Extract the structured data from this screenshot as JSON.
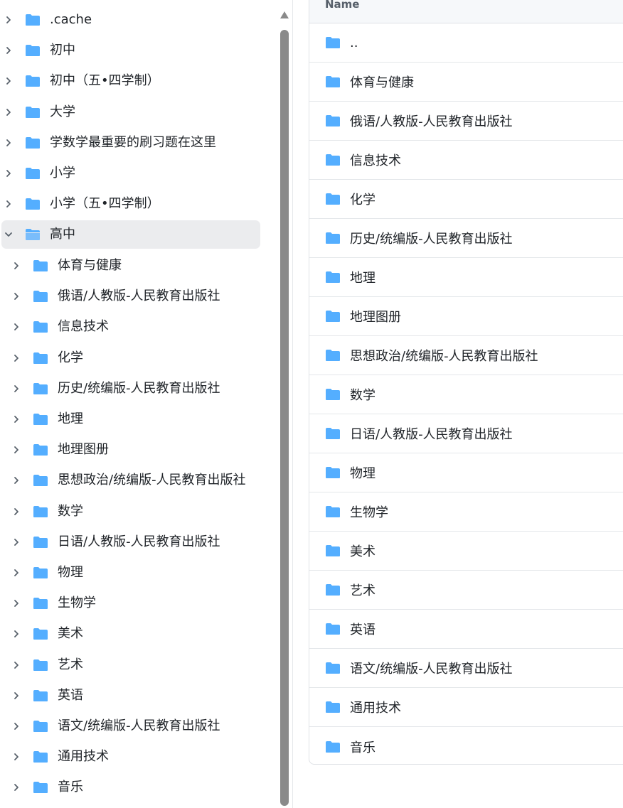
{
  "tree": {
    "root_items": [
      {
        "label": ".cache",
        "expanded": false
      },
      {
        "label": "初中",
        "expanded": false
      },
      {
        "label": "初中（五•四学制）",
        "expanded": false
      },
      {
        "label": "大学",
        "expanded": false
      },
      {
        "label": "学数学最重要的刷习题在这里",
        "expanded": false
      },
      {
        "label": "小学",
        "expanded": false
      },
      {
        "label": "小学（五•四学制）",
        "expanded": false
      },
      {
        "label": "高中",
        "expanded": true,
        "selected": true
      }
    ],
    "child_items": [
      "体育与健康",
      "俄语/人教版-人民教育出版社",
      "信息技术",
      "化学",
      "历史/统编版-人民教育出版社",
      "地理",
      "地理图册",
      "思想政治/统编版-人民教育出版社",
      "数学",
      "日语/人教版-人民教育出版社",
      "物理",
      "生物学",
      "美术",
      "艺术",
      "英语",
      "语文/统编版-人民教育出版社",
      "通用技术",
      "音乐"
    ]
  },
  "list": {
    "header": "Name",
    "rows": [
      "..",
      "体育与健康",
      "俄语/人教版-人民教育出版社",
      "信息技术",
      "化学",
      "历史/统编版-人民教育出版社",
      "地理",
      "地理图册",
      "思想政治/统编版-人民教育出版社",
      "数学",
      "日语/人教版-人民教育出版社",
      "物理",
      "生物学",
      "美术",
      "艺术",
      "英语",
      "语文/统编版-人民教育出版社",
      "通用技术",
      "音乐"
    ]
  },
  "colors": {
    "folder": "#54aeff",
    "selected_bg": "#ebecee",
    "scrollbar": "#8a8a8a",
    "header_bg": "#f6f8fa"
  },
  "icons": {
    "collapsed": "chevron-right-icon",
    "expanded": "chevron-down-icon",
    "folder": "folder-icon",
    "folder_open": "folder-open-icon"
  }
}
